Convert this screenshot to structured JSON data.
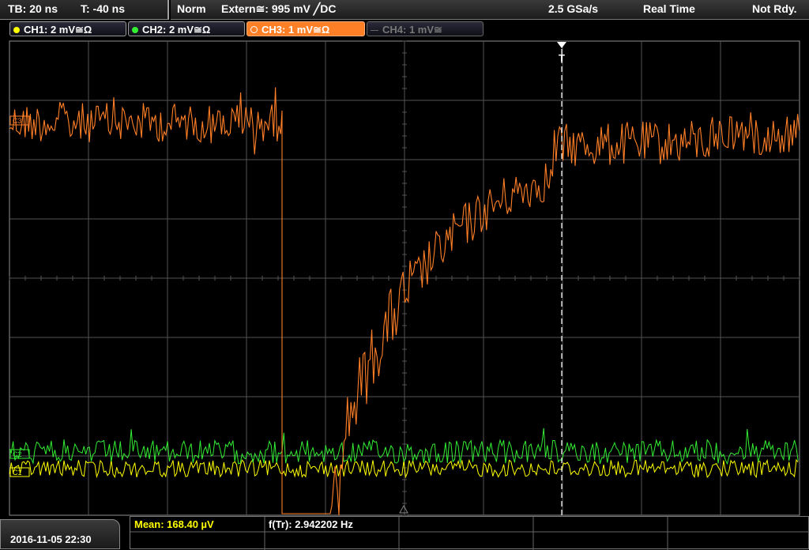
{
  "timebase": {
    "tb": "TB: 20 ns",
    "trig_time": "T: -40 ns"
  },
  "status": {
    "mode": "Norm",
    "trigger": "Extern≅: 995 mV ╱DC",
    "sample_rate": "2.5 GSa/s",
    "acq_mode": "Real Time",
    "state": "Not Rdy."
  },
  "channels": [
    {
      "label": "CH1: 2 mV≅Ω",
      "color": "#ffff00",
      "active": true
    },
    {
      "label": "CH2: 2 mV≅Ω",
      "color": "#33ee33",
      "active": true
    },
    {
      "label": "CH3: 1 mV≅Ω",
      "color": "#ff7f27",
      "active": true,
      "selected": true
    },
    {
      "label": "CH4: 1 mV≅",
      "color": "#777777",
      "active": false
    }
  ],
  "markers": {
    "ch3": "C3",
    "ch2": "C2",
    "ch1": "C1",
    "trigger": "T"
  },
  "datetime": "2016-11-05 22:30",
  "measurements": [
    {
      "label": "Mean: 168.40 µV",
      "color": "#ffff00"
    },
    {
      "label": "f(Tr): 2.942202 Hz",
      "color": "#ffffff"
    }
  ],
  "colors": {
    "grid": "#555555",
    "ch1": "#ffff00",
    "ch2": "#33ee33",
    "ch3": "#ff7f27",
    "trigger_line": "#ffffff"
  }
}
